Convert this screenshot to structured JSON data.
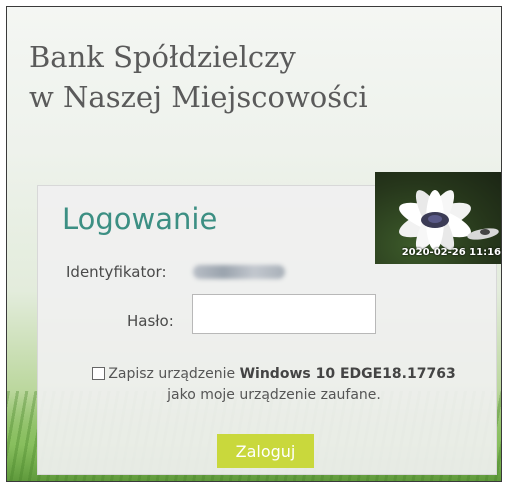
{
  "header": {
    "bank_name_line1": "Bank Spółdzielczy",
    "bank_name_line2": "w Naszej Miejscowości"
  },
  "login": {
    "title": "Logowanie",
    "identifier_label": "Identyfikator:",
    "password_label": "Hasło:",
    "password_value": "",
    "remember_prefix": "Zapisz urządzenie",
    "device_name": "Windows 10 EDGE18.17763",
    "remember_suffix": "jako moje urządzenie zaufane.",
    "remember_checked": false,
    "submit_label": "Zaloguj"
  },
  "security_image": {
    "icon": "daisy-flower-image",
    "date_text": "2020-02-26 11:16"
  },
  "colors": {
    "title": "#3c8f83",
    "button": "#c9d83c"
  }
}
